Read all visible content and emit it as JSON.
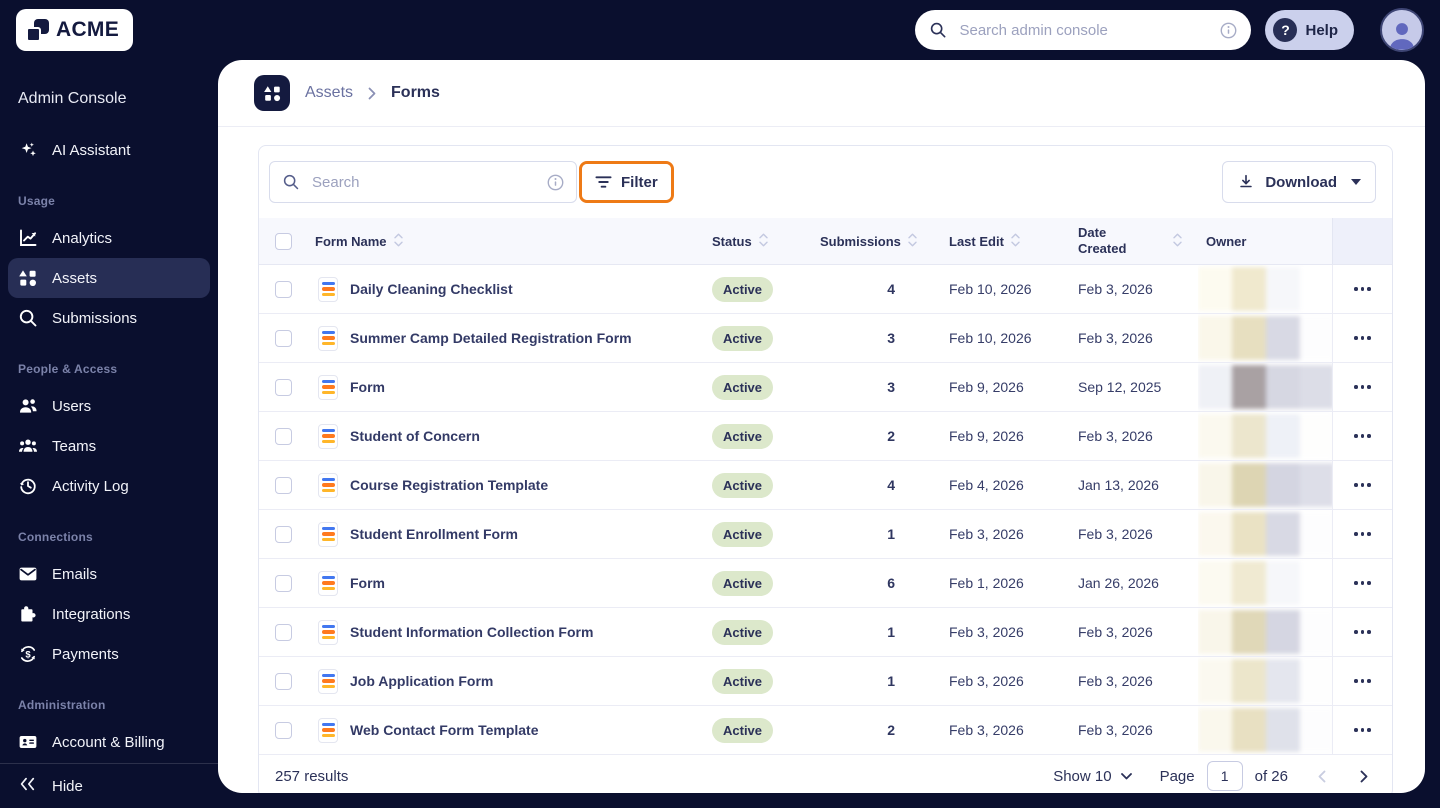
{
  "colors": {
    "navy_bg": "#0A0F2E",
    "accent_highlight": "#EE7A16",
    "active_badge_bg": "#DCE8CB",
    "brand_navy": "#141A3F",
    "form_icon_stripes": [
      "#4277F0",
      "#FF7A1F",
      "#FFB629"
    ]
  },
  "icons": {
    "logo-mark-icon": "overlapping-squares",
    "magnifier-icon": "magnifier",
    "info-icon": "circled-i",
    "help-icon": "question-mark",
    "avatar-icon": "person",
    "sparkles-icon": "sparkles",
    "analytics-icon": "line-chart",
    "assets-icon": "shapes-grid",
    "users-icon": "two-people",
    "teams-icon": "three-people",
    "activity-log-icon": "clock-history",
    "email-icon": "envelope",
    "puzzle-icon": "puzzle-piece",
    "payments-icon": "dollar-cycle",
    "id-card-icon": "id-card",
    "hide-icon": "double-chevron-left",
    "filter-icon": "filter-lines",
    "download-icon": "download-arrow",
    "caret-down-icon": "triangle-down",
    "sort-icon": "up-down-chevrons",
    "dots-icon": "ellipsis"
  },
  "topbar": {
    "logo_text": "ACME",
    "search_placeholder": "Search admin console",
    "help_label": "Help"
  },
  "sidebar": {
    "title": "Admin Console",
    "assistant_label": "AI Assistant",
    "sections": [
      {
        "label": "Usage",
        "items": [
          {
            "label": "Analytics",
            "icon": "analytics-icon",
            "active": false
          },
          {
            "label": "Assets",
            "icon": "assets-icon",
            "active": true
          },
          {
            "label": "Submissions",
            "icon": "magnifier-icon",
            "active": false
          }
        ]
      },
      {
        "label": "People & Access",
        "items": [
          {
            "label": "Users",
            "icon": "users-icon",
            "active": false
          },
          {
            "label": "Teams",
            "icon": "teams-icon",
            "active": false
          },
          {
            "label": "Activity Log",
            "icon": "activity-log-icon",
            "active": false
          }
        ]
      },
      {
        "label": "Connections",
        "items": [
          {
            "label": "Emails",
            "icon": "email-icon",
            "active": false
          },
          {
            "label": "Integrations",
            "icon": "puzzle-icon",
            "active": false
          },
          {
            "label": "Payments",
            "icon": "payments-icon",
            "active": false
          }
        ]
      },
      {
        "label": "Administration",
        "items": [
          {
            "label": "Account & Billing",
            "icon": "id-card-icon",
            "active": false
          }
        ]
      }
    ],
    "hide_label": "Hide"
  },
  "breadcrumb": {
    "parent": "Assets",
    "current": "Forms"
  },
  "toolbar": {
    "search_placeholder": "Search",
    "filter_label": "Filter",
    "download_label": "Download"
  },
  "table": {
    "columns": [
      {
        "label": "Form Name",
        "sortable": true
      },
      {
        "label": "Status",
        "sortable": true
      },
      {
        "label": "Submissions",
        "sortable": true
      },
      {
        "label": "Last Edit",
        "sortable": true
      },
      {
        "label": "Date Created",
        "sortable": true
      },
      {
        "label": "Owner",
        "sortable": false
      }
    ],
    "rows": [
      {
        "name": "Daily Cleaning Checklist",
        "status": "Active",
        "submissions": "4",
        "last_edit": "Feb 10, 2026",
        "date_created": "Feb 3, 2026",
        "owner_blocks": [
          "#FDFBF0",
          "#F0E9CE",
          "#F6F7FA",
          "#FFFFFF"
        ]
      },
      {
        "name": "Summer Camp Detailed Registration Form",
        "status": "Active",
        "submissions": "3",
        "last_edit": "Feb 10, 2026",
        "date_created": "Feb 3, 2026",
        "owner_blocks": [
          "#FAF7EA",
          "#E7DFC0",
          "#D8D9E4",
          "#FDFDFE"
        ]
      },
      {
        "name": "Form",
        "status": "Active",
        "submissions": "3",
        "last_edit": "Feb 9, 2026",
        "date_created": "Sep 12, 2025",
        "owner_blocks": [
          "#EFF1F6",
          "#A9A1A3",
          "#D6D7E2",
          "#DCDDE7"
        ]
      },
      {
        "name": "Student of Concern",
        "status": "Active",
        "submissions": "2",
        "last_edit": "Feb 9, 2026",
        "date_created": "Feb 3, 2026",
        "owner_blocks": [
          "#FBF9EF",
          "#ECE6CD",
          "#EEF1F7",
          "#FEFEFD"
        ]
      },
      {
        "name": "Course Registration Template",
        "status": "Active",
        "submissions": "4",
        "last_edit": "Feb 4, 2026",
        "date_created": "Jan 13, 2026",
        "owner_blocks": [
          "#F9F6EA",
          "#DDD5B3",
          "#D4D5E1",
          "#DDDEE8"
        ]
      },
      {
        "name": "Student Enrollment Form",
        "status": "Active",
        "submissions": "1",
        "last_edit": "Feb 3, 2026",
        "date_created": "Feb 3, 2026",
        "owner_blocks": [
          "#FBF8EE",
          "#EAE2C4",
          "#D8D9E4",
          "#FDFDFE"
        ]
      },
      {
        "name": "Form",
        "status": "Active",
        "submissions": "6",
        "last_edit": "Feb 1, 2026",
        "date_created": "Jan 26, 2026",
        "owner_blocks": [
          "#FCFAF1",
          "#F0EAD2",
          "#F6F7FA",
          "#FFFFFF"
        ]
      },
      {
        "name": "Student Information Collection Form",
        "status": "Active",
        "submissions": "1",
        "last_edit": "Feb 3, 2026",
        "date_created": "Feb 3, 2026",
        "owner_blocks": [
          "#F9F6EA",
          "#E0D8B8",
          "#D5D6E2",
          "#FDFDFE"
        ]
      },
      {
        "name": "Job Application Form",
        "status": "Active",
        "submissions": "1",
        "last_edit": "Feb 3, 2026",
        "date_created": "Feb 3, 2026",
        "owner_blocks": [
          "#FBF9F0",
          "#ECE6CB",
          "#E4E6EE",
          "#FEFEFE"
        ]
      },
      {
        "name": "Web Contact Form Template",
        "status": "Active",
        "submissions": "2",
        "last_edit": "Feb 3, 2026",
        "date_created": "Feb 3, 2026",
        "owner_blocks": [
          "#FAF8ED",
          "#E8E0C2",
          "#DFE1EA",
          "#FDFDFE"
        ]
      }
    ]
  },
  "footer": {
    "results": "257 results",
    "show_label": "Show 10",
    "page_label": "Page",
    "page_value": "1",
    "of_label": "of 26"
  }
}
